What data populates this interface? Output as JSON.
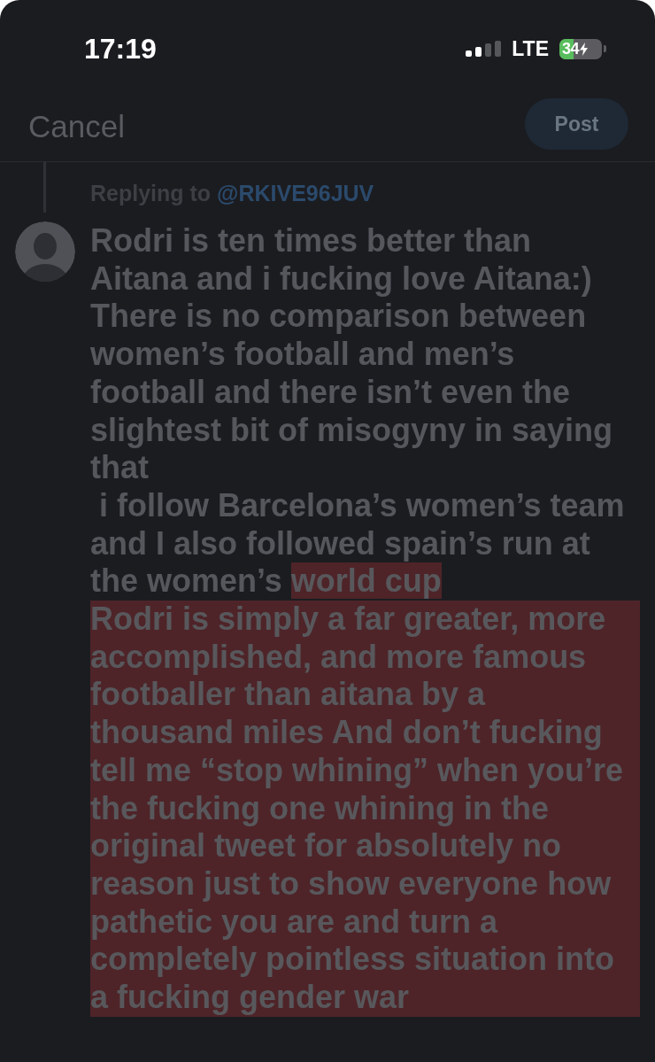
{
  "status_bar": {
    "time": "17:19",
    "network": "LTE",
    "battery": "34"
  },
  "nav": {
    "cancel": "Cancel",
    "post": {
      "label": "Post",
      "disabled": true
    }
  },
  "replying_to": {
    "label": "Replying to",
    "handle": "@RKIVE96JUV"
  },
  "compose": {
    "text": "Rodri is ten times better than Aitana and i fucking love Aitana:)\nThere is no comparison between women’s football and men’s football and there isn’t even the slightest bit of misogyny in saying that\n i follow Barcelona’s women’s team and I also followed spain’s run at the women’s ",
    "overflow_text": "world cup\nRodri is simply a far greater, more accomplished, and more famous footballer than aitana by a thousand miles And don’t fucking tell me “stop whining” when you’re the fucking one whining in the original tweet for absolutely no reason just to show everyone how pathetic you are and turn a completely pointless situation into a fucking gender war"
  }
}
